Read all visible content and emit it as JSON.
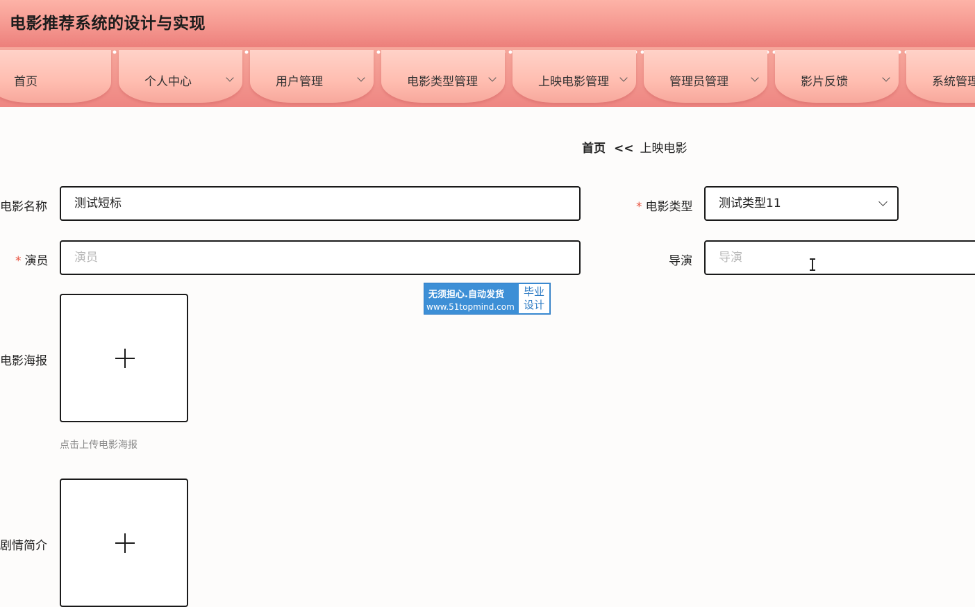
{
  "app": {
    "title": "电影推荐系统的设计与实现"
  },
  "nav": {
    "items": [
      {
        "label": "首页",
        "has_dropdown": false
      },
      {
        "label": "个人中心",
        "has_dropdown": true
      },
      {
        "label": "用户管理",
        "has_dropdown": true
      },
      {
        "label": "电影类型管理",
        "has_dropdown": true
      },
      {
        "label": "上映电影管理",
        "has_dropdown": true
      },
      {
        "label": "管理员管理",
        "has_dropdown": true
      },
      {
        "label": "影片反馈",
        "has_dropdown": true
      },
      {
        "label": "系统管理",
        "has_dropdown": true
      }
    ]
  },
  "breadcrumb": {
    "home": "首页",
    "separator": "<<",
    "current": "上映电影"
  },
  "form": {
    "required_mark": "*",
    "movie_name": {
      "label": "电影名称",
      "value": "测试短标"
    },
    "movie_type": {
      "label": "电影类型",
      "value": "测试类型11",
      "required": true
    },
    "actors": {
      "label": "演员",
      "placeholder": "演员",
      "required": true
    },
    "director": {
      "label": "导演",
      "placeholder": "导演"
    },
    "poster": {
      "label": "电影海报",
      "hint": "点击上传电影海报"
    },
    "plot": {
      "label": "剧情简介"
    }
  },
  "watermark": {
    "line1": "无须担心.自动发货",
    "line2": "www.51topmind.com",
    "badge_line1": "毕业",
    "badge_line2": "设计"
  },
  "colors": {
    "header_top": "#fdb3a7",
    "header_bottom": "#ec7f7b",
    "required": "#e8523e",
    "watermark_blue": "#3d8fd6"
  }
}
